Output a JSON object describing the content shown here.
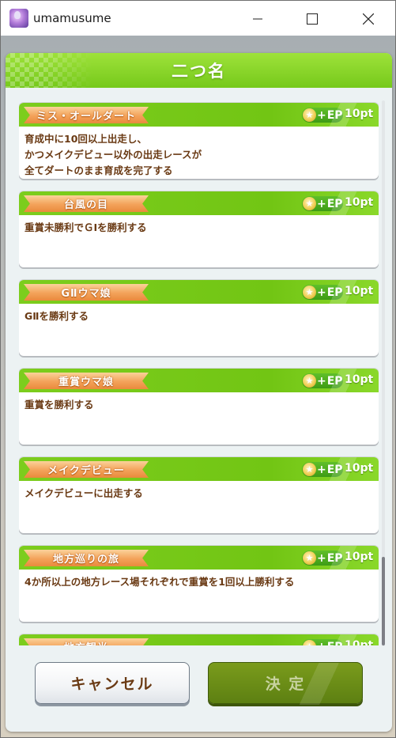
{
  "window": {
    "title": "umamusume",
    "minimize_icon": "minimize-icon",
    "maximize_icon": "maximize-icon",
    "close_icon": "close-icon"
  },
  "dialog": {
    "title": "二つ名",
    "reward_label": "EP",
    "reward_icon": "star-plus-icon"
  },
  "titles": [
    {
      "name": "ミス・オールダート",
      "points": "10pt",
      "description": "育成中に10回以上出走し、\nかつメイクデビュー以外の出走レースが\n全てダートのまま育成を完了する"
    },
    {
      "name": "台風の目",
      "points": "10pt",
      "description": "重賞未勝利でＧⅠを勝利する"
    },
    {
      "name": "GⅡウマ娘",
      "points": "10pt",
      "description": "GⅡを勝利する"
    },
    {
      "name": "重賞ウマ娘",
      "points": "10pt",
      "description": "重賞を勝利する"
    },
    {
      "name": "メイクデビュー",
      "points": "10pt",
      "description": "メイクデビューに出走する"
    },
    {
      "name": "地方巡りの旅",
      "points": "10pt",
      "description": "4か所以上の地方レース場それぞれで重賞を1回以上勝利する"
    },
    {
      "name": "地方観光",
      "points": "10pt",
      "description": ""
    }
  ],
  "buttons": {
    "cancel": "キャンセル",
    "confirm": "決 定"
  },
  "colors": {
    "header_green": "#7ccd1d",
    "ribbon_orange": "#f3a25a",
    "text_brown": "#6a3a14",
    "confirm_green": "#5d8012"
  }
}
